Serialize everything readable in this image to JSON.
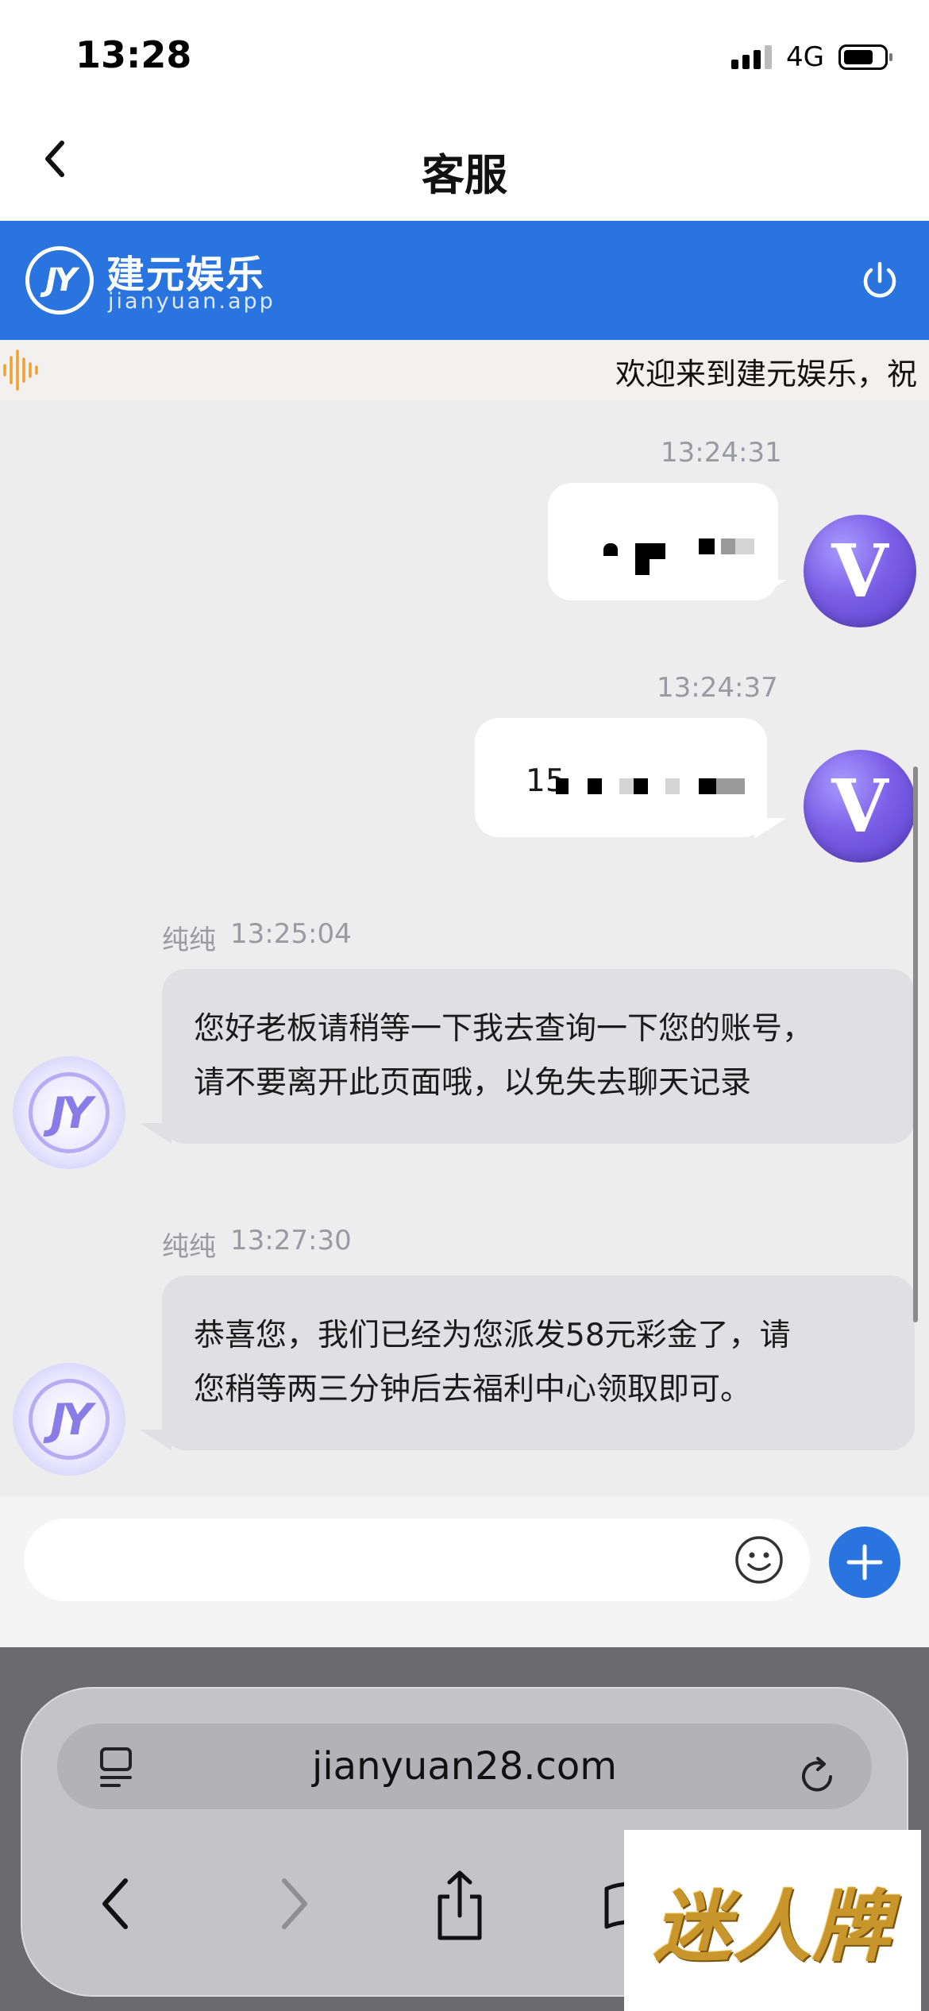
{
  "status_bar": {
    "time": "13:28",
    "network": "4G"
  },
  "nav": {
    "title": "客服"
  },
  "brand": {
    "name": "建元娱乐",
    "domain": "jianyuan.app"
  },
  "marquee": {
    "text": "欢迎来到建元娱乐，祝"
  },
  "messages": [
    {
      "direction": "out",
      "time": "13:24:31",
      "text_visible": ""
    },
    {
      "direction": "out",
      "time": "13:24:37",
      "text_visible": "15"
    },
    {
      "direction": "in",
      "sender": "纯纯",
      "time": "13:25:04",
      "lines": [
        "您好老板请稍等一下我去查询一下您的账号，",
        "请不要离开此页面哦，以免失去聊天记录"
      ]
    },
    {
      "direction": "in",
      "sender": "纯纯",
      "time": "13:27:30",
      "lines": [
        "恭喜您，我们已经为您派发58元彩金了，请",
        "您稍等两三分钟后去福利中心领取即可。"
      ]
    }
  ],
  "browser": {
    "url": "jianyuan28.com"
  },
  "watermark": {
    "text": "迷人牌"
  },
  "colors": {
    "brand_blue": "#2a74e0",
    "chat_bg": "#ededed",
    "avatar_purple": "#7a5fe6"
  }
}
